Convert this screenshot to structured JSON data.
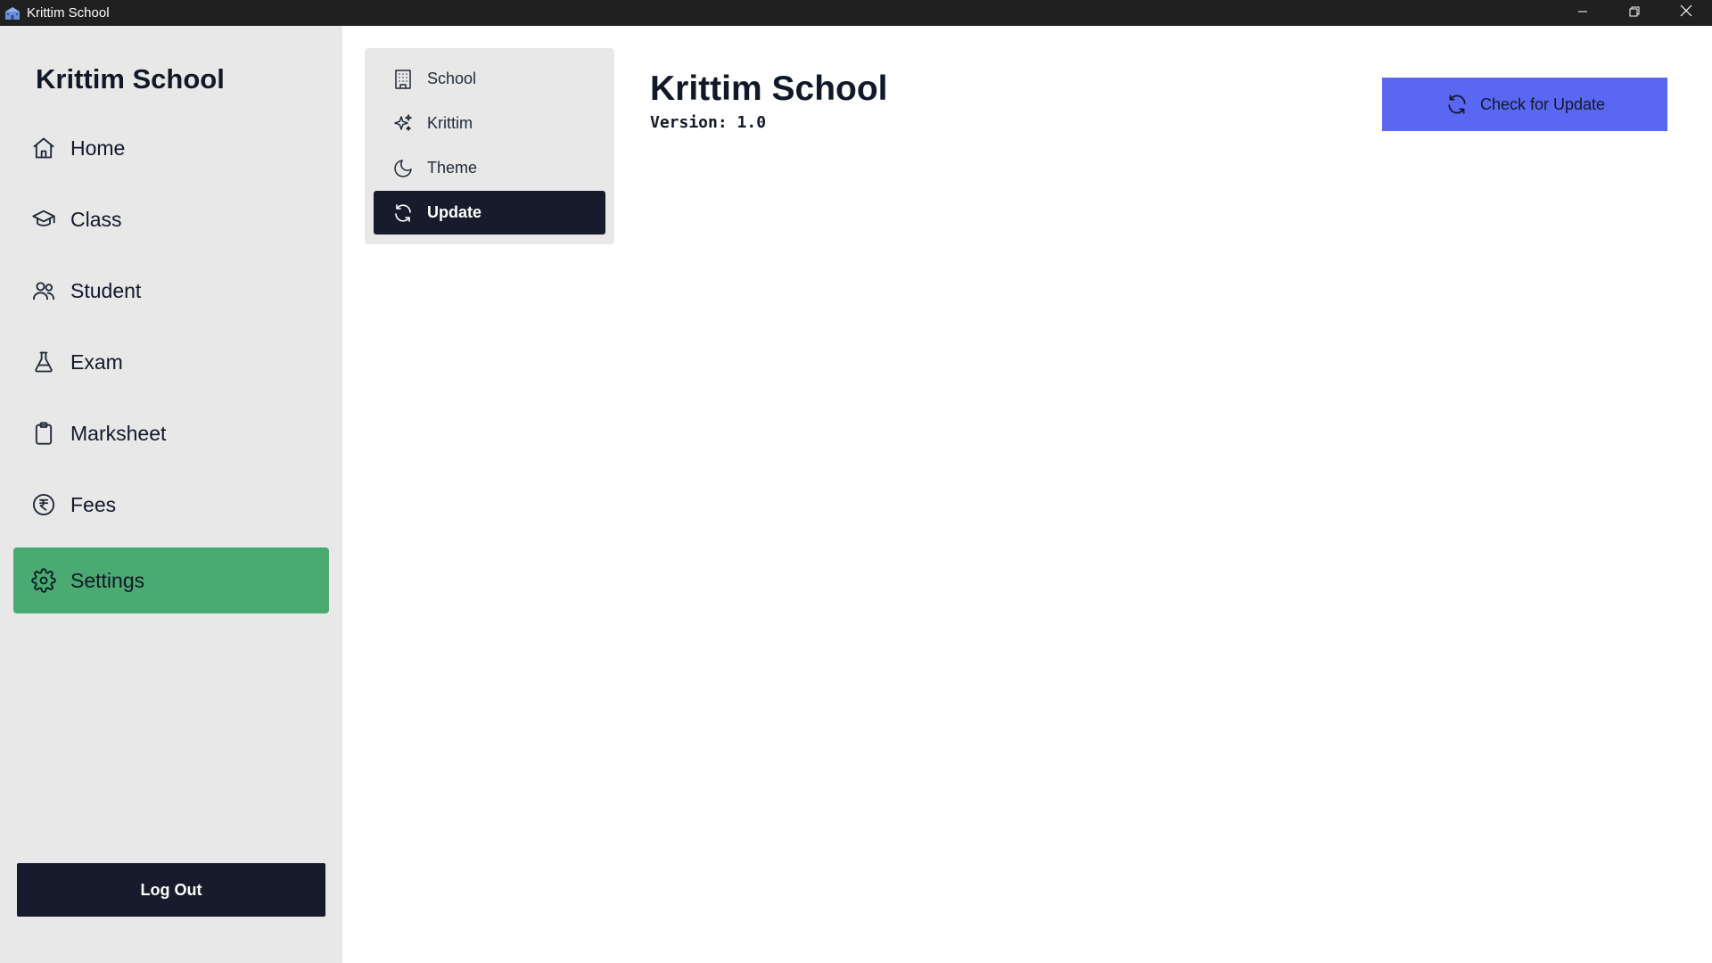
{
  "window": {
    "title": "Krittim School",
    "icon": "school-building-icon",
    "controls": [
      "minimize-icon",
      "restore-icon",
      "close-icon"
    ]
  },
  "sidebar": {
    "brand": "Krittim School",
    "items": [
      {
        "label": "Home",
        "icon": "home-icon"
      },
      {
        "label": "Class",
        "icon": "graduation-cap-icon"
      },
      {
        "label": "Student",
        "icon": "users-icon"
      },
      {
        "label": "Exam",
        "icon": "flask-icon"
      },
      {
        "label": "Marksheet",
        "icon": "clipboard-icon"
      },
      {
        "label": "Fees",
        "icon": "rupee-icon"
      },
      {
        "label": "Settings",
        "icon": "gear-icon",
        "active": true
      }
    ],
    "logout_label": "Log Out"
  },
  "settings_menu": {
    "items": [
      {
        "label": "School",
        "icon": "building-icon"
      },
      {
        "label": "Krittim",
        "icon": "sparkles-icon"
      },
      {
        "label": "Theme",
        "icon": "moon-icon"
      },
      {
        "label": "Update",
        "icon": "refresh-icon",
        "active": true
      }
    ]
  },
  "main": {
    "title": "Krittim School",
    "version": "Version: 1.0",
    "update_button_label": "Check for Update"
  },
  "colors": {
    "sidebar_bg": "#e8e8e8",
    "active_nav": "#4aaa71",
    "dark": "#181b2b",
    "accent": "#5a67f2"
  }
}
